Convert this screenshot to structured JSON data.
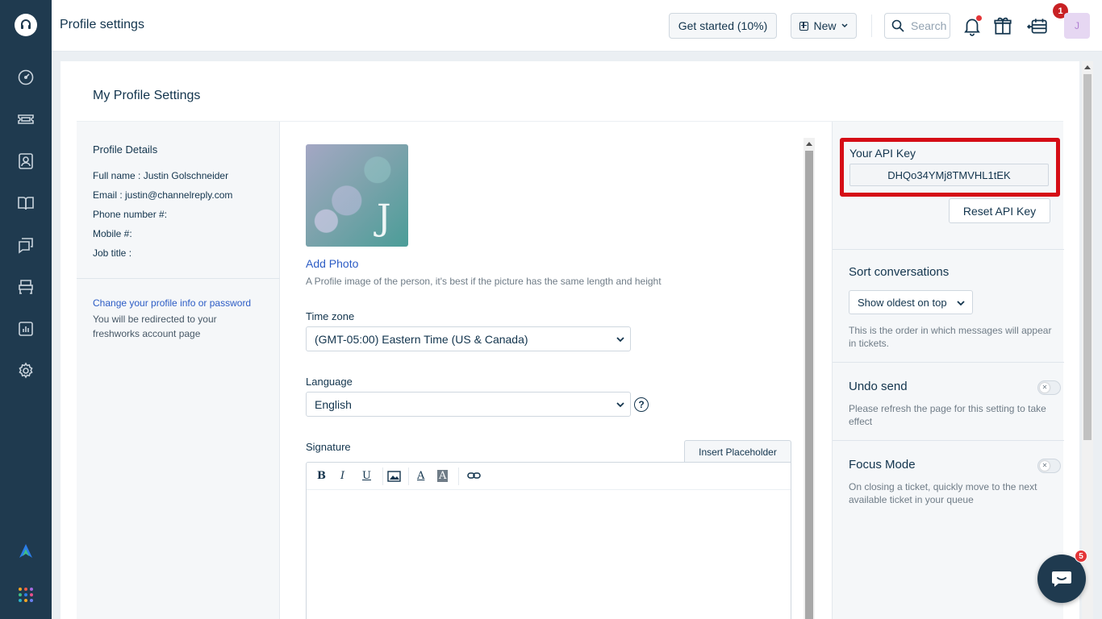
{
  "topbar": {
    "title": "Profile settings",
    "get_started": "Get started (10%)",
    "new_label": "New",
    "search_placeholder": "Search",
    "gift_count": "1",
    "avatar_initial": "J"
  },
  "sidebar": {
    "items": [
      "dashboard-icon",
      "tickets-icon",
      "contacts-icon",
      "solutions-icon",
      "forums-icon",
      "team-huddle-icon",
      "reports-icon",
      "admin-settings-icon"
    ]
  },
  "card": {
    "title": "My Profile Settings"
  },
  "profile_details": {
    "heading": "Profile Details",
    "full_name_label": "Full name : ",
    "full_name": "Justin Golschneider",
    "email_label": "Email : ",
    "email": "justin@channelreply.com",
    "phone_label": "Phone number #:",
    "mobile_label": "Mobile #:",
    "job_title_label": "Job title :",
    "change_link": "Change your profile info or password",
    "redirect_note": "You will be redirected to your freshworks account page"
  },
  "profile_form": {
    "photo_initial": "J",
    "add_photo": "Add Photo",
    "photo_note": "A Profile image of the person, it's best if the picture has the same length and height",
    "timezone_label": "Time zone",
    "timezone_value": "(GMT-05:00) Eastern Time (US & Canada)",
    "language_label": "Language",
    "language_value": "English",
    "help_glyph": "?",
    "signature_label": "Signature",
    "insert_placeholder": "Insert Placeholder",
    "toolbar": {
      "bold": "B",
      "italic": "I",
      "underline": "U",
      "font_color": "A",
      "bg_color": "A"
    }
  },
  "api": {
    "label": "Your API Key",
    "value": "DHQo34YMj8TMVHL1tEK",
    "reset": "Reset API Key"
  },
  "sort": {
    "title": "Sort conversations",
    "value": "Show oldest on top",
    "note": "This is the order in which messages will appear in tickets."
  },
  "undo_send": {
    "title": "Undo send",
    "note": "Please refresh the page for this setting to take effect",
    "enabled": false
  },
  "focus_mode": {
    "title": "Focus Mode",
    "note": "On closing a ticket, quickly move to the next available ticket in your queue",
    "enabled": false
  },
  "chat": {
    "badge": "5"
  },
  "colors": {
    "sidebar": "#1f3a4f",
    "link": "#2c5cc5",
    "highlight": "#d50d16",
    "badge": "#c82124"
  }
}
